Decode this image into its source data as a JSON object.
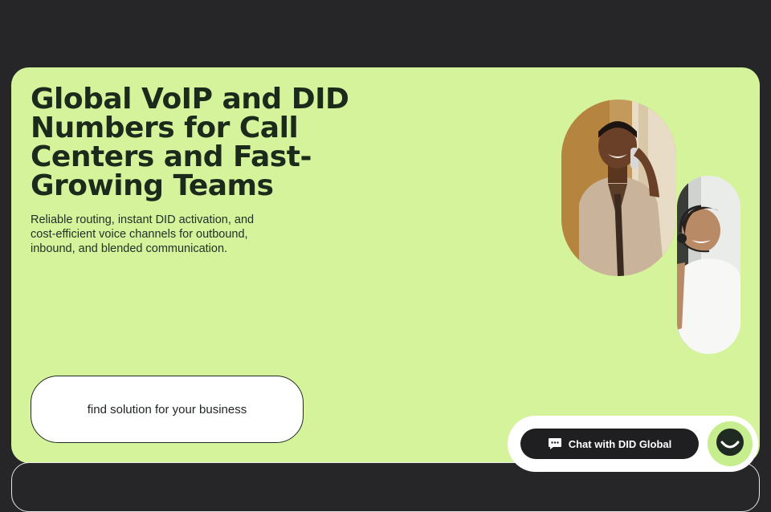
{
  "hero": {
    "title": "Global VoIP and DID Numbers for Call Centers and Fast-Growing Teams",
    "subtitle": "Reliable routing, instant DID activation, and cost-efficient voice channels for outbound, inbound, and blended communication.",
    "cta_label": "find solution for your business"
  },
  "images": {
    "photo_1": "smiling-man-on-phone",
    "photo_2": "agent-with-headset"
  },
  "chat_widget": {
    "button_label": "Chat with DID Global",
    "chat_icon": "chat-bubble-icon",
    "launcher_icon": "smile-face-icon"
  },
  "colors": {
    "page_background": "#262628",
    "hero_background": "#d4f39b",
    "title_text": "#1c2a1c",
    "chat_button": "#1f1f22",
    "launcher": "#c6ee8e"
  }
}
